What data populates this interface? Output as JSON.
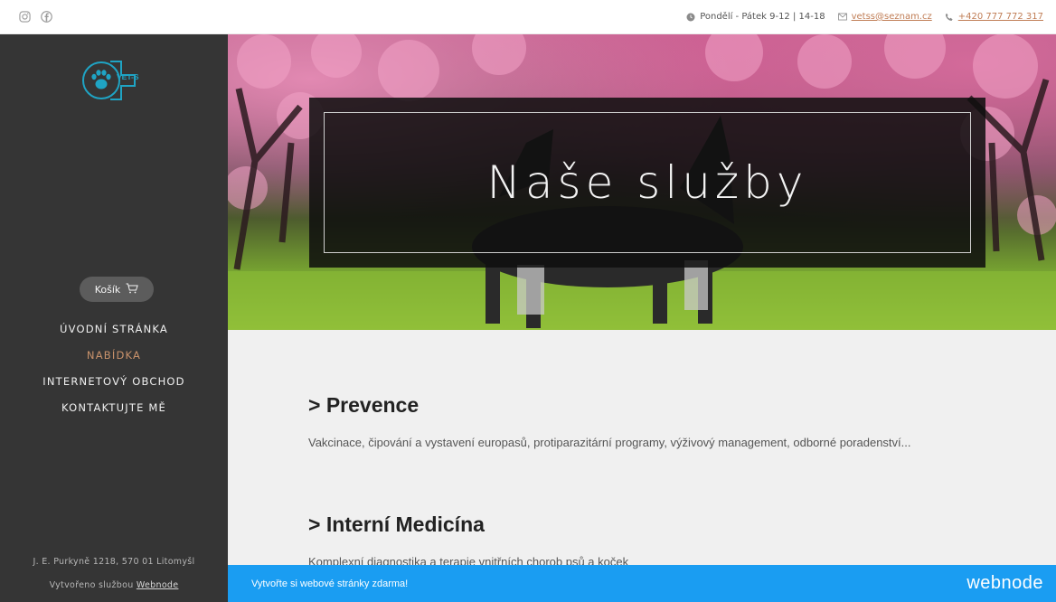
{
  "topbar": {
    "hours": "Pondělí - Pátek 9-12 | 14-18",
    "email": "vetss@seznam.cz",
    "phone": "+420 777 772 317",
    "icons": [
      "instagram-icon",
      "facebook-icon",
      "clock-icon",
      "mail-icon",
      "phone-icon"
    ]
  },
  "sidebar": {
    "logo_text": "VET-S",
    "cart_label": "Košík",
    "nav": [
      {
        "label": "ÚVODNÍ STRÁNKA",
        "active": false
      },
      {
        "label": "NABÍDKA",
        "active": true
      },
      {
        "label": "INTERNETOVÝ OBCHOD",
        "active": false
      },
      {
        "label": "KONTAKTUJTE MĚ",
        "active": false
      }
    ],
    "address": "J. E. Purkyně 1218, 570 01 Litomyšl",
    "made_by_prefix": "Vytvořeno službou",
    "made_by_link": "Webnode"
  },
  "hero": {
    "title": "Naše služby"
  },
  "content": {
    "sections": [
      {
        "heading": "> Prevence",
        "text": "Vakcinace, čipování a vystavení europasů, protiparazitární programy, výživový management, odborné poradenství..."
      },
      {
        "heading": "> Interní Medicína",
        "text": "Komplexní diagnostika a terapie vnitřních chorob psů a koček"
      }
    ]
  },
  "banner": {
    "message": "Vytvořte si webové stránky zdarma!",
    "brand": "webnode"
  },
  "colors": {
    "accent": "#c9926b",
    "link": "#c07d55",
    "sidebar_bg": "#353535",
    "banner_bg": "#1a9df2",
    "logo": "#1fa4c4"
  }
}
